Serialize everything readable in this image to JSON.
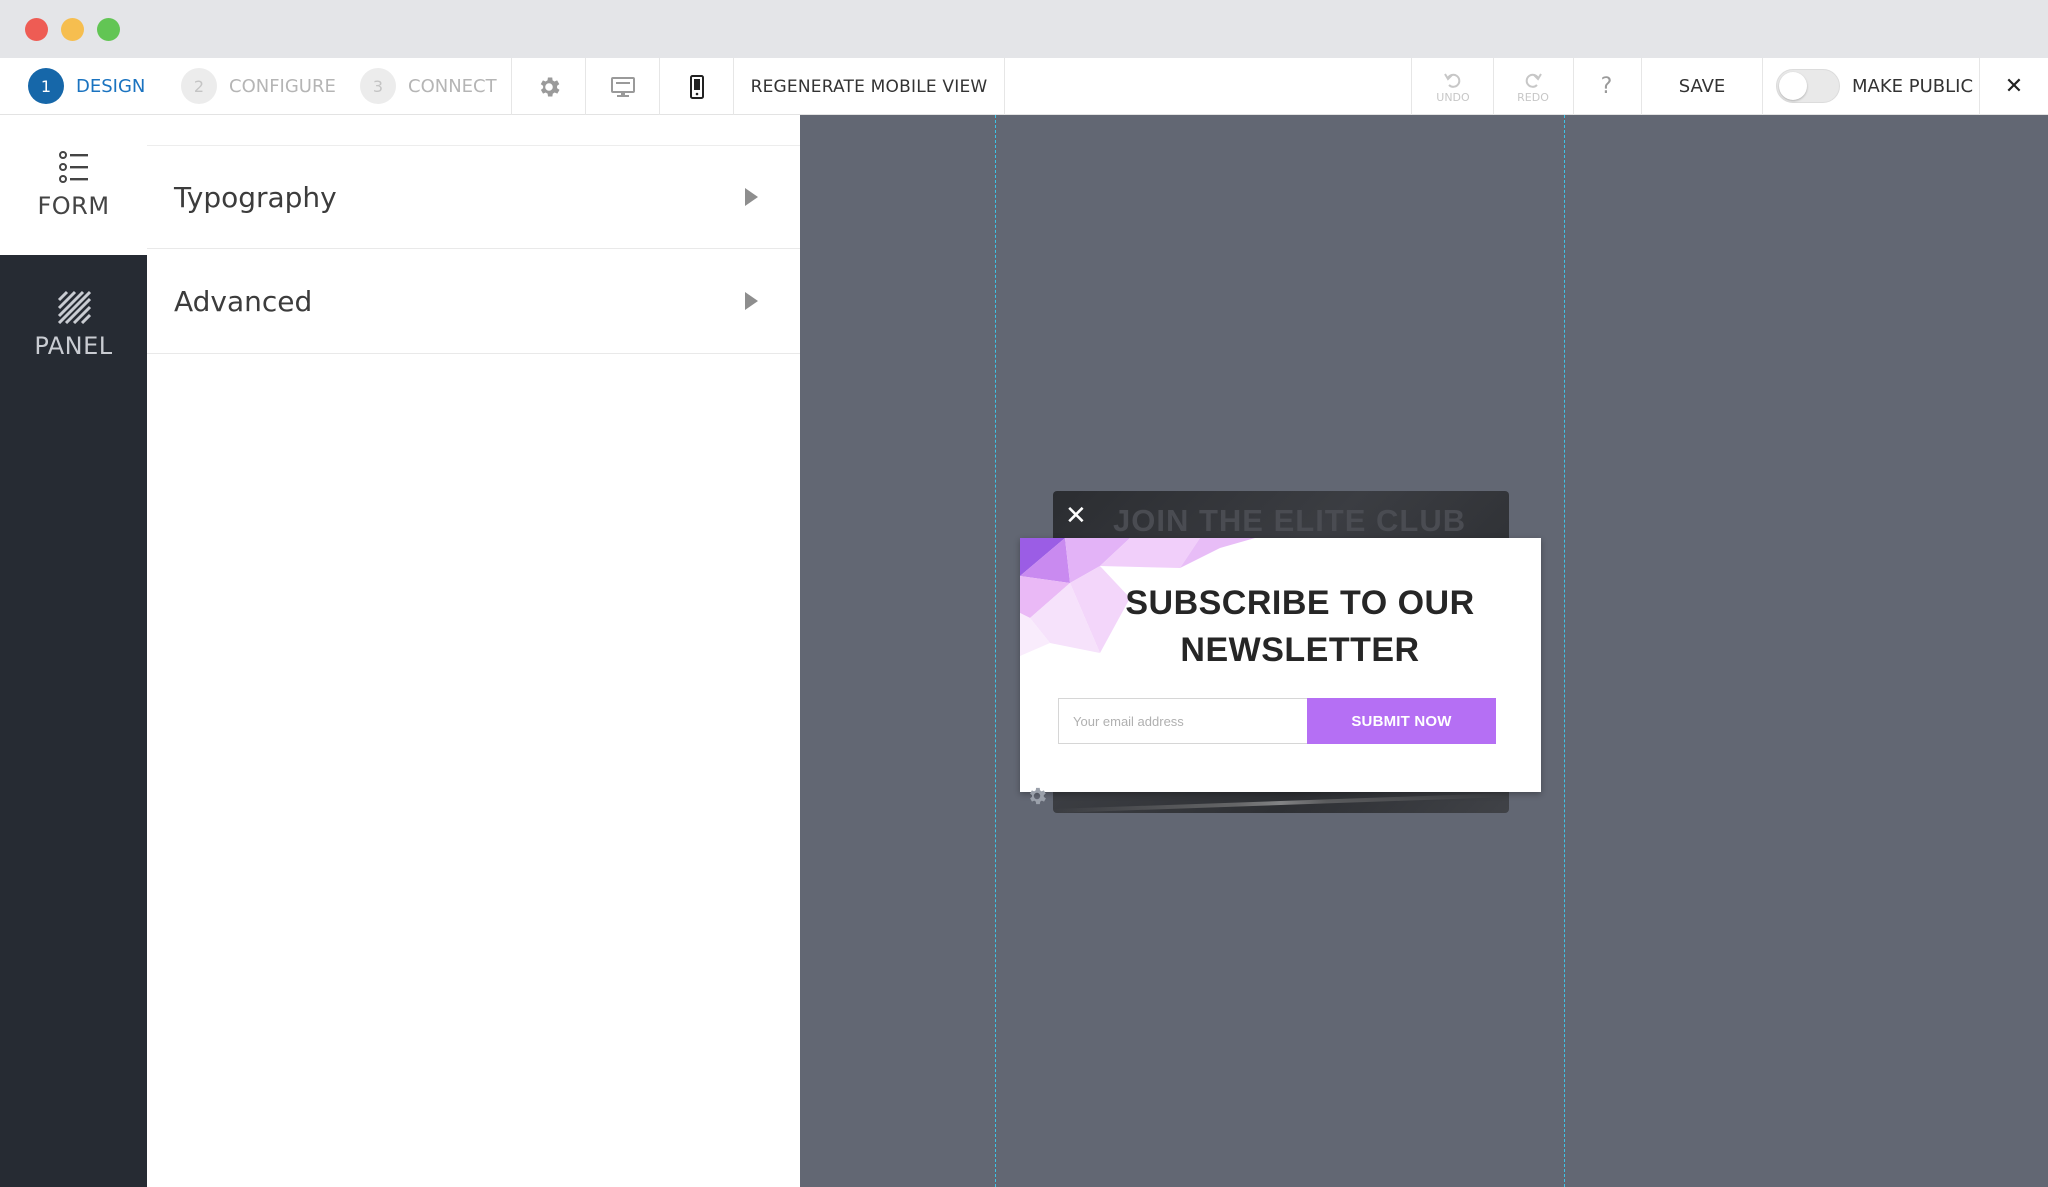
{
  "toolbar": {
    "steps": [
      {
        "num": "1",
        "label": "DESIGN"
      },
      {
        "num": "2",
        "label": "CONFIGURE"
      },
      {
        "num": "3",
        "label": "CONNECT"
      }
    ],
    "icons": [
      "gear-icon",
      "desktop-icon",
      "mobile-icon"
    ],
    "regenerate_label": "REGENERATE MOBILE VIEW",
    "undo_label": "UNDO",
    "redo_label": "REDO",
    "help_label": "?",
    "save_label": "SAVE",
    "make_public_label": "MAKE PUBLIC",
    "make_public_on": false,
    "close_label": "✕"
  },
  "rail": {
    "tabs": [
      {
        "label": "FORM",
        "icon": "list-icon",
        "active": true
      },
      {
        "label": "PANEL",
        "icon": "hatch-icon",
        "active": false
      }
    ]
  },
  "panel": {
    "sections": [
      {
        "label": "Typography"
      },
      {
        "label": "Advanced"
      }
    ]
  },
  "canvas": {
    "background_popup": {
      "title": "JOIN THE ELITE CLUB",
      "close": "✕"
    },
    "popup": {
      "headline": "SUBSCRIBE TO OUR NEWSLETTER",
      "email_placeholder": "Your email address",
      "submit_label": "SUBMIT NOW"
    }
  },
  "colors": {
    "accent": "#1667a9",
    "canvas_bg": "#626773",
    "rail_bg": "#262b33",
    "submit_bg": "#b56ff4",
    "guide": "#3ec3e6"
  }
}
